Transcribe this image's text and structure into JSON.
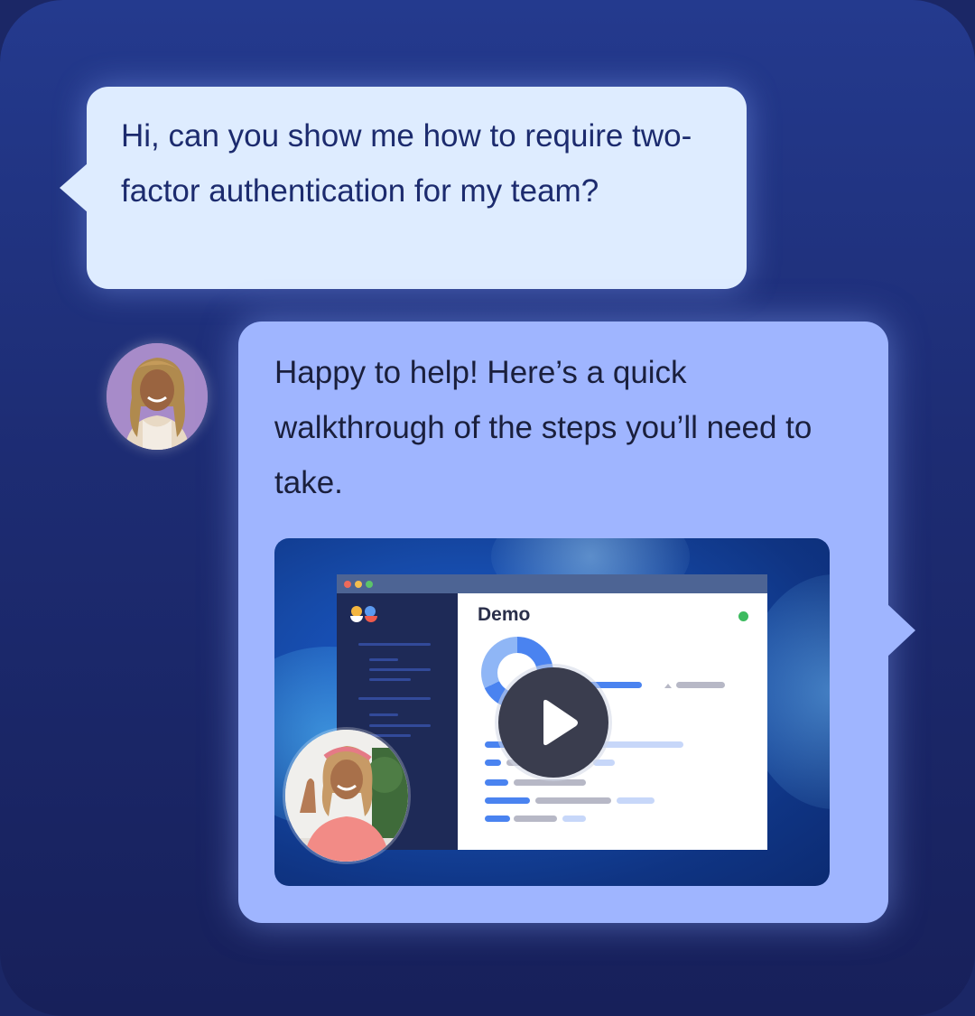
{
  "conversation": {
    "user_message": "Hi, can you show me how to require two-factor authentication for my team?",
    "agent_message": "Happy to help! Here’s a quick walkthrough of the steps you’ll need to take."
  },
  "video": {
    "app_title": "Demo",
    "play_icon": "play-icon",
    "status_color": "#3dbb5f"
  },
  "colors": {
    "background": "#1d2c73",
    "user_bubble": "#deecff",
    "agent_bubble": "#9fb5ff",
    "accent": "#4a83f0"
  }
}
